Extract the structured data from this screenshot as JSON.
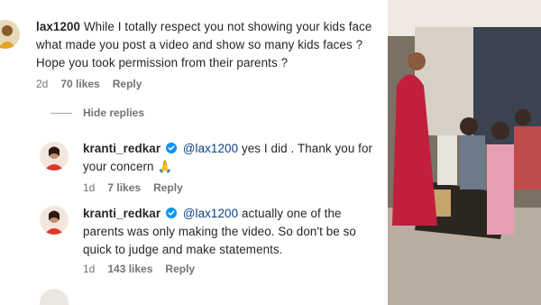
{
  "comments": [
    {
      "username": "lax1200",
      "text": "While I totally respect you not showing your kids face what made you post a video and show so many kids faces ? Hope you took permission from their parents ?",
      "time": "2d",
      "likes": "70 likes",
      "reply_label": "Reply"
    }
  ],
  "hide_replies_label": "Hide replies",
  "replies": [
    {
      "username": "kranti_redkar",
      "mention": "@lax1200",
      "text": "yes I did . Thank you for your concern",
      "emoji": "🙏",
      "time": "1d",
      "likes": "7 likes",
      "reply_label": "Reply"
    },
    {
      "username": "kranti_redkar",
      "mention": "@lax1200",
      "text": "actually one of the parents was only making the video. So don't be so quick to judge and make statements.",
      "time": "1d",
      "likes": "143 likes",
      "reply_label": "Reply"
    }
  ],
  "colors": {
    "verified": "#0095f6",
    "mention": "#0a3f86",
    "meta": "#737373"
  }
}
